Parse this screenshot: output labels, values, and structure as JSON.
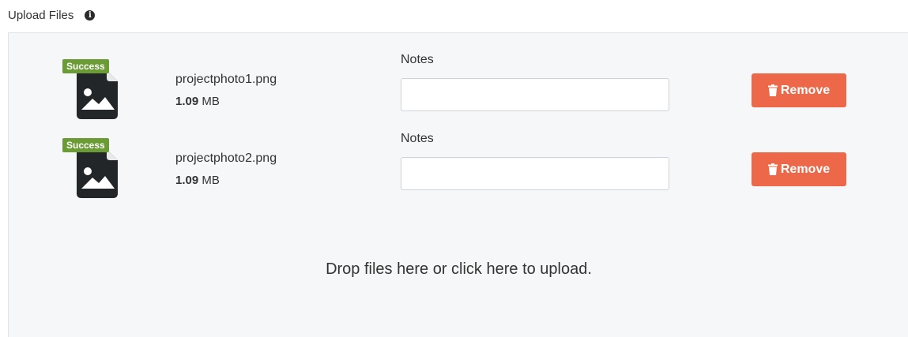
{
  "header": {
    "title": "Upload Files",
    "info_icon": "info-icon"
  },
  "files": [
    {
      "status": "Success",
      "name": "projectphoto1.png",
      "size_value": "1.09",
      "size_unit": "MB",
      "notes_label": "Notes",
      "notes_value": "",
      "remove_label": "Remove",
      "icon": "image-file-icon"
    },
    {
      "status": "Success",
      "name": "projectphoto2.png",
      "size_value": "1.09",
      "size_unit": "MB",
      "notes_label": "Notes",
      "notes_value": "",
      "remove_label": "Remove",
      "icon": "image-file-icon"
    }
  ],
  "dropzone": {
    "message": "Drop files here or click here to upload."
  },
  "colors": {
    "success": "#6a9b34",
    "remove": "#ec6848",
    "dropzone_bg": "#f6f7f9"
  }
}
